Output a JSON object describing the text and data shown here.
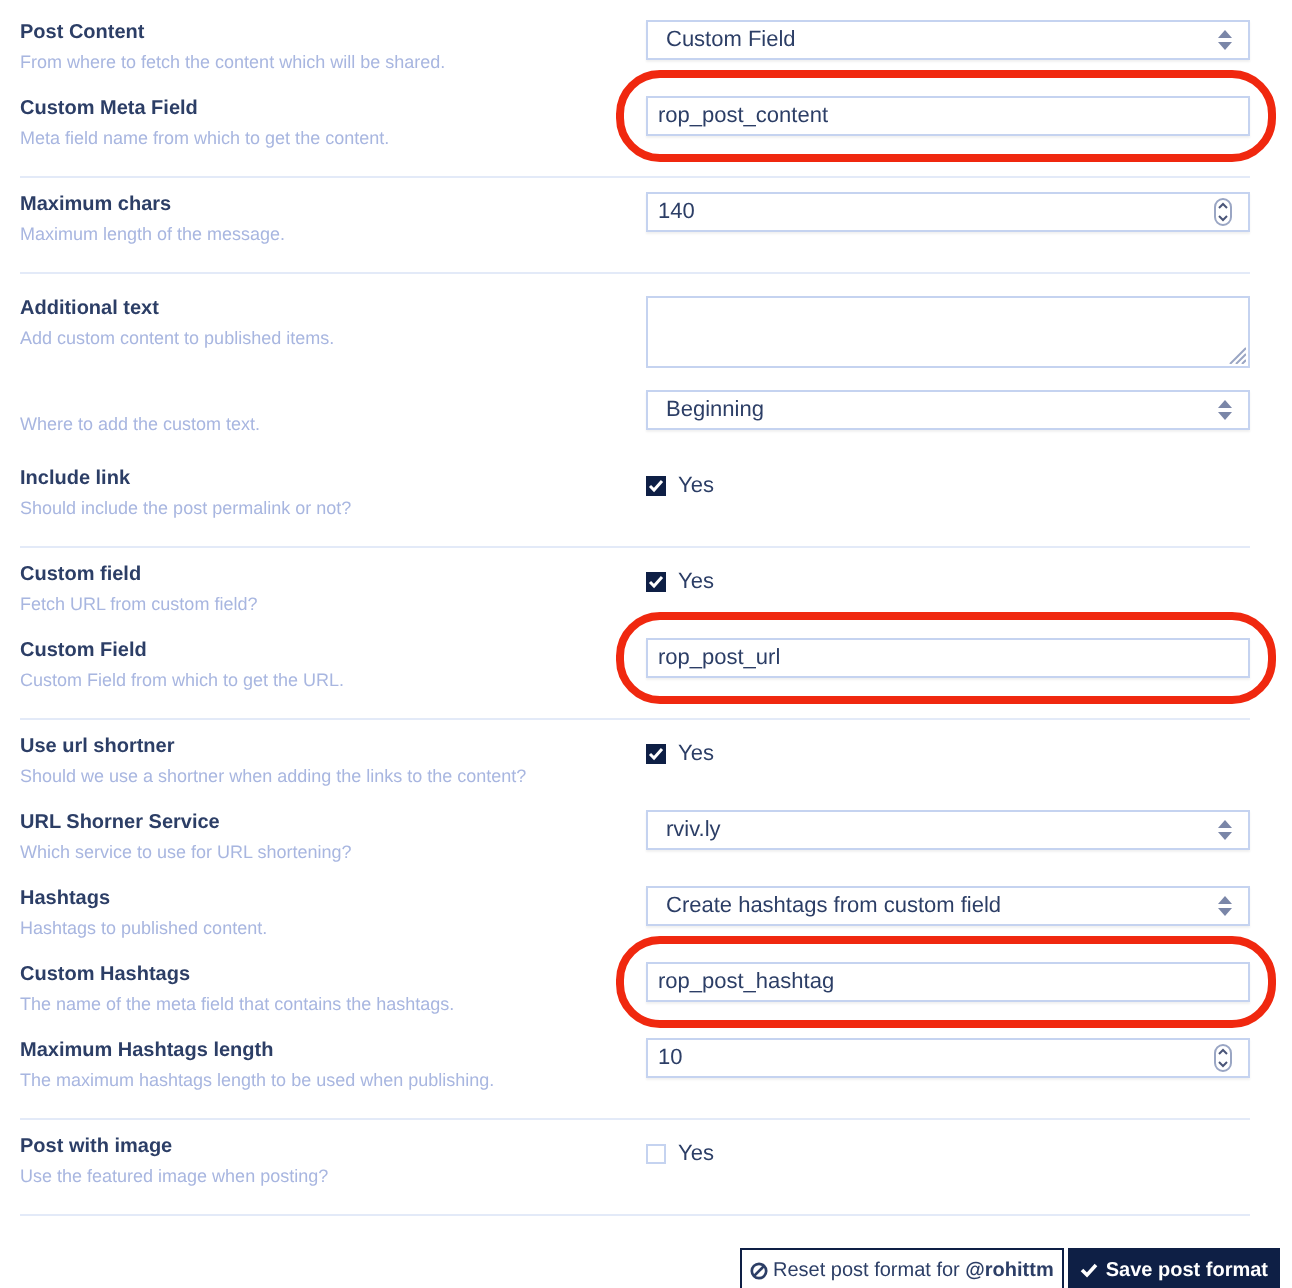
{
  "groups": [
    {
      "rows": [
        {
          "label": "Post Content",
          "description": "From where to fetch the content which will be shared.",
          "control": {
            "kind": "select",
            "value": "Custom Field"
          }
        },
        {
          "label": "Custom Meta Field",
          "description": "Meta field name from which to get the content.",
          "control": {
            "kind": "text",
            "value": "rop_post_content",
            "highlighted": true
          }
        }
      ]
    },
    {
      "rows": [
        {
          "label": "Maximum chars",
          "description": "Maximum length of the message.",
          "control": {
            "kind": "number",
            "value": "140"
          }
        }
      ]
    },
    {
      "rows": [
        {
          "label": "Additional text",
          "description": "Add custom content to published items.",
          "control": {
            "kind": "textarea"
          }
        },
        {
          "description": "Where to add the custom text.",
          "control": {
            "kind": "select",
            "value": "Beginning"
          }
        },
        {
          "label": "Include link",
          "description": "Should include the post permalink or not?",
          "control": {
            "kind": "checkbox",
            "label": "Yes",
            "checked": true
          }
        }
      ]
    },
    {
      "rows": [
        {
          "label": "Custom field",
          "description": "Fetch URL from custom field?",
          "control": {
            "kind": "checkbox",
            "label": "Yes",
            "checked": true
          }
        },
        {
          "label": "Custom Field",
          "description": "Custom Field from which to get the URL.",
          "control": {
            "kind": "text",
            "value": "rop_post_url",
            "highlighted": true
          }
        }
      ]
    },
    {
      "rows": [
        {
          "label": "Use url shortner",
          "description": "Should we use a shortner when adding the links to the content?",
          "control": {
            "kind": "checkbox",
            "label": "Yes",
            "checked": true
          }
        },
        {
          "label": "URL Shorner Service",
          "description": "Which service to use for URL shortening?",
          "control": {
            "kind": "select",
            "value": "rviv.ly"
          }
        },
        {
          "label": "Hashtags",
          "description": "Hashtags to published content.",
          "control": {
            "kind": "select",
            "value": "Create hashtags from custom field"
          }
        },
        {
          "label": "Custom Hashtags",
          "description": "The name of the meta field that contains the hashtags.",
          "control": {
            "kind": "text",
            "value": "rop_post_hashtag",
            "highlighted": true
          }
        },
        {
          "label": "Maximum Hashtags length",
          "description": "The maximum hashtags length to be used when publishing.",
          "control": {
            "kind": "number",
            "value": "10"
          }
        }
      ]
    },
    {
      "rows": [
        {
          "label": "Post with image",
          "description": "Use the featured image when posting?",
          "control": {
            "kind": "checkbox",
            "label": "Yes",
            "checked": false
          }
        }
      ]
    }
  ],
  "buttons": [
    {
      "kind": "reset",
      "label": "Reset post format for **@rohittm**"
    },
    {
      "kind": "save",
      "label": "Save post format"
    }
  ]
}
